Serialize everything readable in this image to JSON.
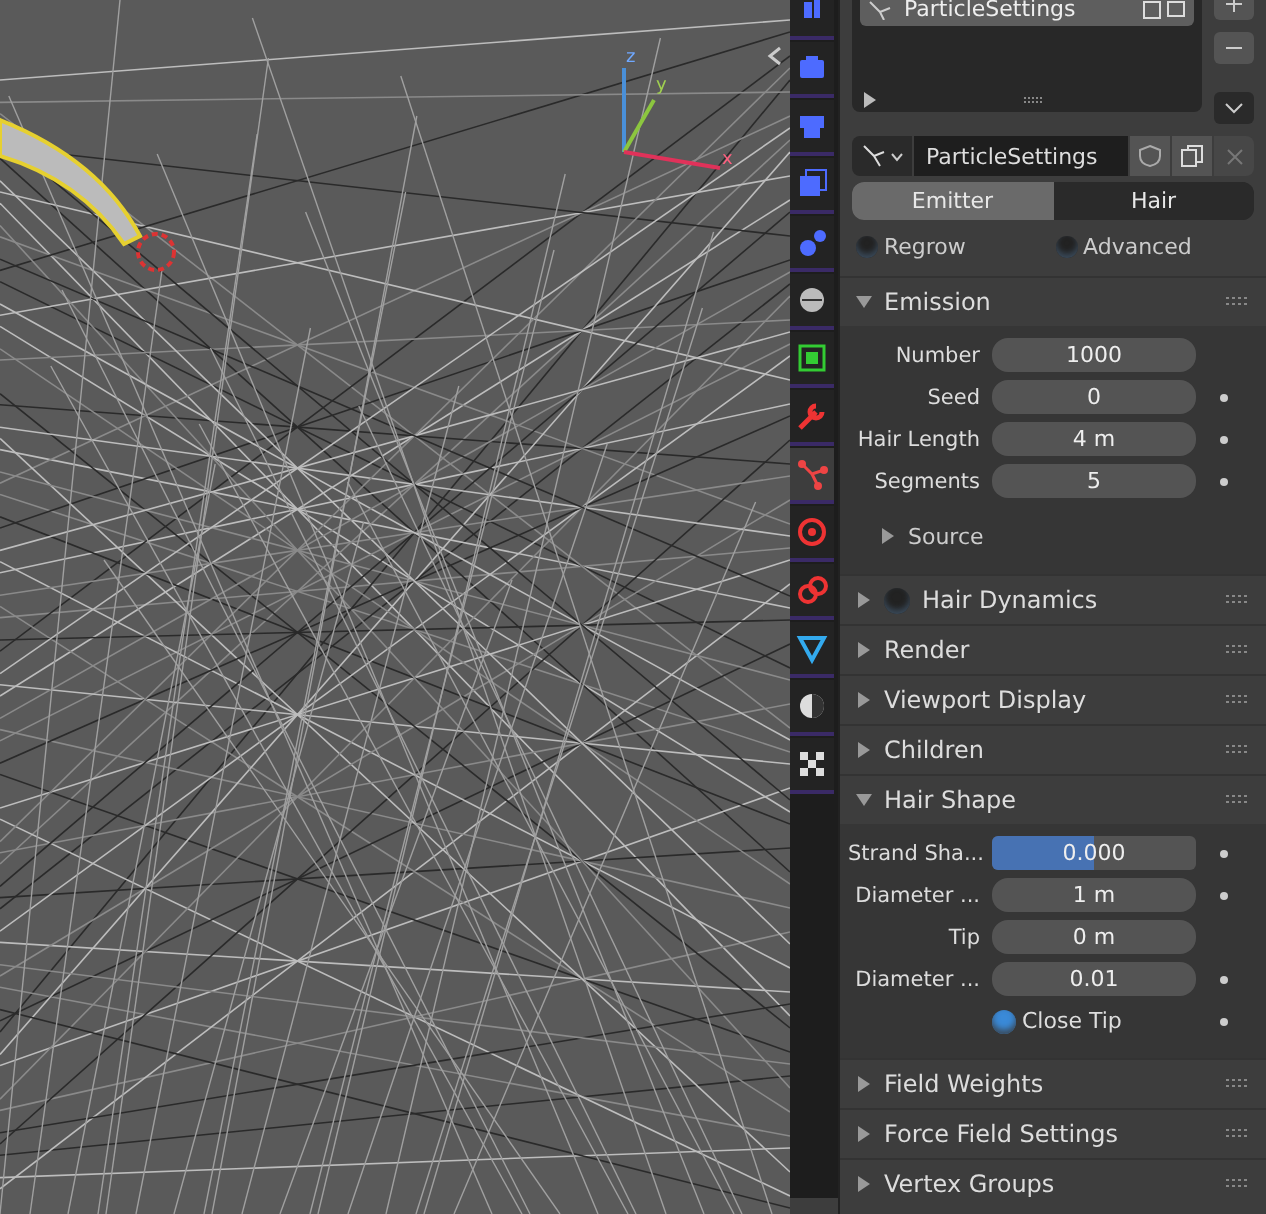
{
  "viewport": {
    "axes": [
      {
        "label": "z"
      },
      {
        "label": "y"
      },
      {
        "label": "x"
      }
    ]
  },
  "tabs": [
    {
      "kind": "tool",
      "selected": false
    },
    {
      "kind": "render",
      "selected": false
    },
    {
      "kind": "output",
      "selected": false
    },
    {
      "kind": "view-layer",
      "selected": false
    },
    {
      "kind": "scene",
      "selected": false
    },
    {
      "kind": "world",
      "selected": false
    },
    {
      "kind": "object",
      "selected": false
    },
    {
      "kind": "modifier",
      "selected": false
    },
    {
      "kind": "particles",
      "selected": true
    },
    {
      "kind": "physics",
      "selected": false
    },
    {
      "kind": "constraints",
      "selected": false
    },
    {
      "kind": "data",
      "selected": false
    },
    {
      "kind": "material",
      "selected": false
    },
    {
      "kind": "texture",
      "selected": false
    }
  ],
  "particle_list": {
    "items": [
      {
        "name": "ParticleSettings",
        "selected": true
      }
    ]
  },
  "datablock": {
    "name": "ParticleSettings"
  },
  "type_toggle": [
    {
      "label": "Emitter",
      "selected": true
    },
    {
      "label": "Hair",
      "selected": false
    }
  ],
  "options": [
    {
      "label": "Regrow",
      "checked": false
    },
    {
      "label": "Advanced",
      "checked": false
    }
  ],
  "panels": [
    {
      "title": "Emission",
      "expanded": true,
      "fields": [
        {
          "kind": "number",
          "label": "Number",
          "value": "1000",
          "decorator": false
        },
        {
          "kind": "number",
          "label": "Seed",
          "value": "0",
          "decorator": true
        },
        {
          "kind": "number",
          "label": "Hair Length",
          "value": "4 m",
          "decorator": true
        },
        {
          "kind": "number",
          "label": "Segments",
          "value": "5",
          "decorator": true
        }
      ],
      "subpanels": [
        {
          "title": "Source",
          "expanded": false
        }
      ]
    },
    {
      "title": "Hair Dynamics",
      "expanded": false,
      "checkbox": false
    },
    {
      "title": "Render",
      "expanded": false
    },
    {
      "title": "Viewport Display",
      "expanded": false
    },
    {
      "title": "Children",
      "expanded": false
    },
    {
      "title": "Hair Shape",
      "expanded": true,
      "fields": [
        {
          "kind": "slider",
          "label": "Strand Sha...",
          "value": "0.000",
          "level": 0.5,
          "decorator": true
        },
        {
          "kind": "number",
          "label": "Diameter ...",
          "value": "1 m",
          "decorator": true
        },
        {
          "kind": "number",
          "label": "Tip",
          "value": "0 m",
          "decorator": false
        },
        {
          "kind": "number",
          "label": "Diameter ...",
          "value": "0.01",
          "decorator": true
        },
        {
          "kind": "checkbox",
          "label": "Close Tip",
          "checked": true,
          "decorator": true
        }
      ]
    },
    {
      "title": "Field Weights",
      "expanded": false
    },
    {
      "title": "Force Field Settings",
      "expanded": false
    },
    {
      "title": "Vertex Groups",
      "expanded": false
    }
  ]
}
